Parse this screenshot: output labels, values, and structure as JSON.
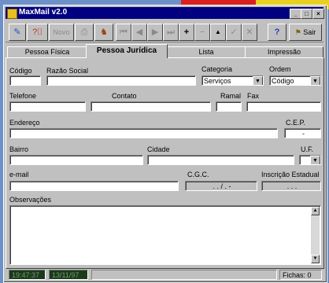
{
  "window": {
    "title": "MaxMail v2.0",
    "min": "_",
    "max": "□",
    "close": "×"
  },
  "toolbar": {
    "edit_glyph": "✎",
    "fichas_glyph": "?⌷",
    "novo_label": "Novo",
    "print_glyph": "⎙",
    "find_glyph": "♞",
    "first_glyph": "⏮",
    "prev_glyph": "◀",
    "next_glyph": "▶",
    "last_glyph": "⏭",
    "add_glyph": "+",
    "remove_glyph": "−",
    "up_glyph": "▲",
    "check_glyph": "✓",
    "cancel_glyph": "✕",
    "help_glyph": "?",
    "exit_label": "Sair"
  },
  "tabs": [
    {
      "label": "Pessoa Física"
    },
    {
      "label": "Pessoa Jurídica"
    },
    {
      "label": "Lista"
    },
    {
      "label": "Impressão"
    }
  ],
  "form": {
    "codigo_label": "Código",
    "codigo_value": "",
    "razao_label": "Razão Social",
    "razao_value": "",
    "categoria_label": "Categoria",
    "categoria_value": "Serviços",
    "ordem_label": "Ordem",
    "ordem_value": "Código",
    "telefone_label": "Telefone",
    "contato_label": "Contato",
    "ramal_label": "Ramal",
    "fax_label": "Fax",
    "endereco_label": "Endereço",
    "cep_label": "C.E.P.",
    "cep_value": "-",
    "bairro_label": "Bairro",
    "cidade_label": "Cidade",
    "uf_label": "U.F.",
    "email_label": "e-mail",
    "cgc_label": "C.G.C.",
    "cgc_value": ". . / . -",
    "inscricao_label": "Inscrição Estadual",
    "inscricao_value": ". . .",
    "obs_label": "Observações"
  },
  "status": {
    "time": "19:47:37",
    "date": "13/11/97",
    "fichas": "Fichas: 0"
  },
  "colors": {
    "titlebar": "#000080",
    "face": "#c0c0c0",
    "desktop": "#6d90c9"
  }
}
